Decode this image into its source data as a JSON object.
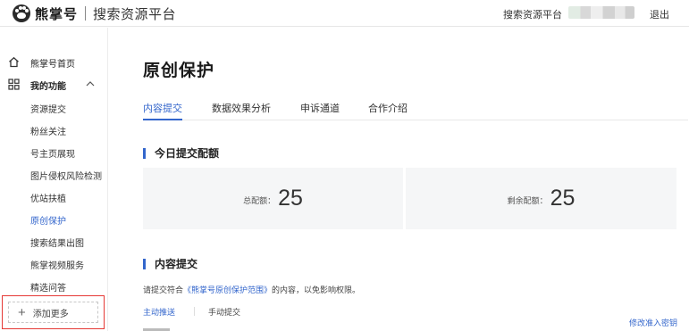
{
  "header": {
    "brand": "熊掌号",
    "subtitle": "搜索资源平台",
    "platform_link": "搜索资源平台",
    "logout": "退出"
  },
  "sidebar": {
    "home": "熊掌号首页",
    "my_functions": "我的功能",
    "items": [
      {
        "label": "资源提交",
        "active": false
      },
      {
        "label": "粉丝关注",
        "active": false
      },
      {
        "label": "号主页展现",
        "active": false
      },
      {
        "label": "图片侵权风险检测",
        "active": false
      },
      {
        "label": "优站扶植",
        "active": false
      },
      {
        "label": "原创保护",
        "active": true
      },
      {
        "label": "搜索结果出图",
        "active": false
      },
      {
        "label": "熊掌视频服务",
        "active": false
      },
      {
        "label": "精选问答",
        "active": false
      }
    ],
    "add_more": "添加更多"
  },
  "main": {
    "title": "原创保护",
    "tabs": [
      {
        "label": "内容提交",
        "active": true
      },
      {
        "label": "数据效果分析",
        "active": false
      },
      {
        "label": "申诉通道",
        "active": false
      },
      {
        "label": "合作介绍",
        "active": false
      }
    ],
    "quota_section_title": "今日提交配额",
    "total_label": "总配额：",
    "total_value": "25",
    "remaining_label": "剩余配额：",
    "remaining_value": "25",
    "content_section_title": "内容提交",
    "notice_prefix": "请提交符合",
    "notice_link": "《熊掌号原创保护范围》",
    "notice_suffix": "的内容，以免影响权限。",
    "subtabs": [
      "主动推送",
      "手动提交"
    ],
    "modify_link": "修改准入密钥"
  },
  "colors": {
    "accent": "#3366cc",
    "highlight_border": "#e53935",
    "quota_bg": "#f5f6f7"
  }
}
